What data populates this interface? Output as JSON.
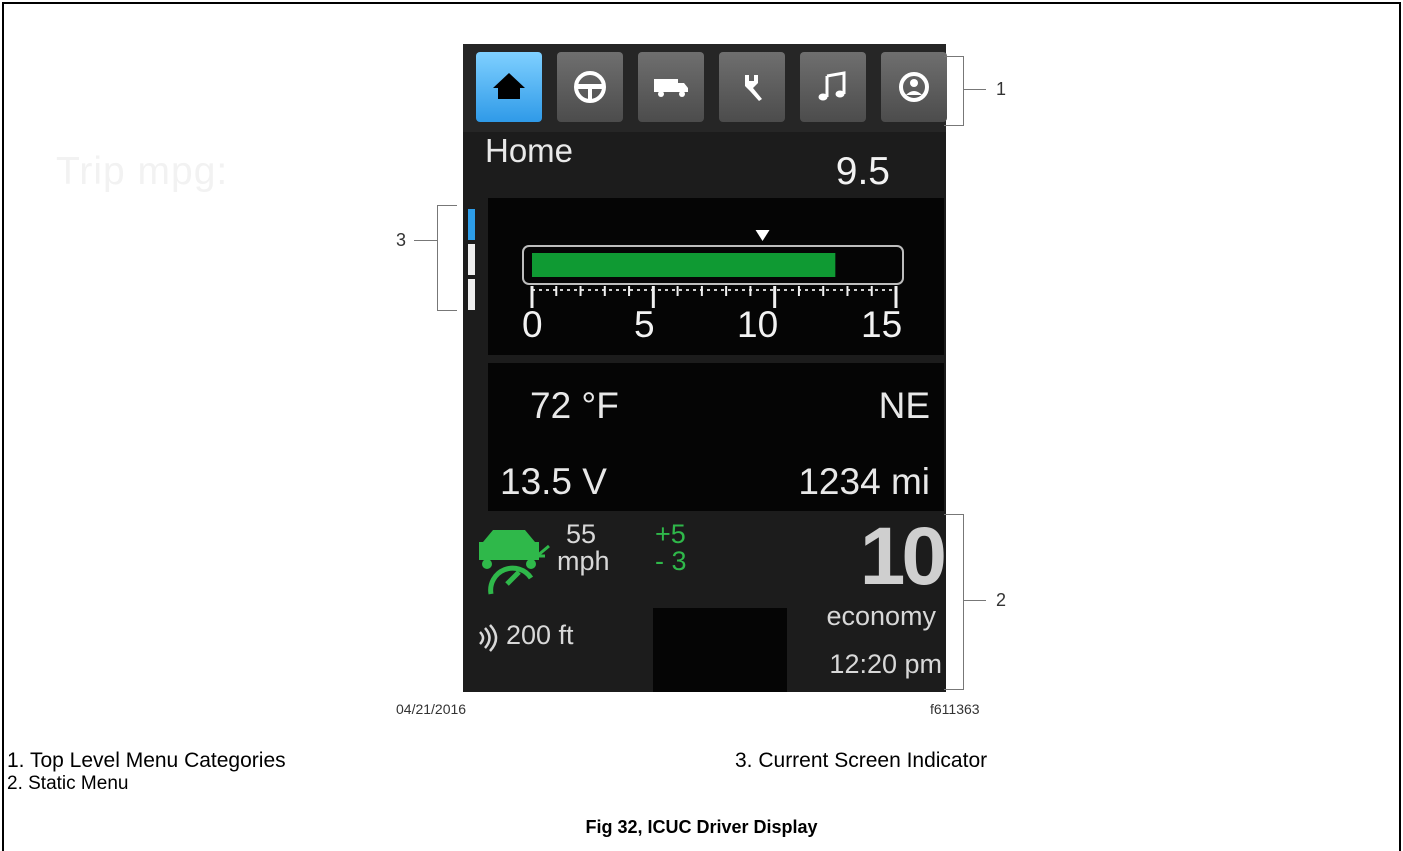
{
  "display": {
    "menu": [
      {
        "name": "home-icon",
        "active": true
      },
      {
        "name": "steering-wheel-icon",
        "active": false
      },
      {
        "name": "truck-icon",
        "active": false
      },
      {
        "name": "wrench-icon",
        "active": false
      },
      {
        "name": "music-note-icon",
        "active": false
      },
      {
        "name": "settings-icon",
        "active": false
      }
    ],
    "screen_title": "Home",
    "trip": {
      "label": "Trip mpg:",
      "value": "9.5",
      "gauge_min": 0,
      "gauge_max": 15,
      "gauge_fill": 12.5,
      "marker": 9.5,
      "ticks": [
        "0",
        "5",
        "10",
        "15"
      ]
    },
    "info": {
      "temp": "72 °F",
      "heading": "NE",
      "voltage": "13.5 V",
      "distance": "1234 mi"
    },
    "static_menu": {
      "set_speed": "55",
      "speed_unit": "mph",
      "plus": "+5",
      "minus": "- 3",
      "gear": "10",
      "mode": "economy",
      "follow_distance": "200 ft",
      "clock": "12:20 pm"
    },
    "screen_indicator_active": 0
  },
  "figure": {
    "date": "04/21/2016",
    "figure_id": "f611363",
    "callouts": [
      "1",
      "2",
      "3"
    ],
    "legend": [
      "1.  Top Level Menu Categories",
      "2.  Static Menu",
      "3.  Current Screen Indicator"
    ],
    "caption": "Fig 32, ICUC Driver Display"
  },
  "colors": {
    "active_blue": "#2d9de9",
    "gauge_green": "#0f9a33",
    "status_green": "#2fb84a",
    "background": "#1c1c1c"
  }
}
